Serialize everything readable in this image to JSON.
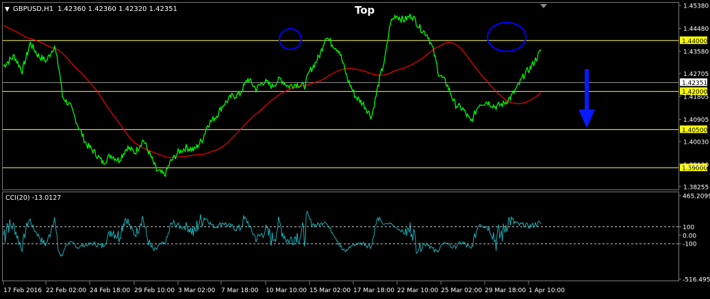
{
  "header": {
    "symbol": "GBPUSD,H1",
    "ohlc": "1.42360 1.42360 1.42320 1.42351",
    "annotation_top": "Top"
  },
  "colors": {
    "background": "#000000",
    "price_line": "#00ff00",
    "ma_line": "#ff0000",
    "level_line": "#ffff66",
    "current_line": "#9a9a9a",
    "circle": "#0000ff",
    "arrow": "#0a1aff",
    "cci_line": "#20c0c8",
    "label_bg": "#ffff00",
    "text": "#ffffff"
  },
  "chart_data": [
    {
      "type": "line",
      "name_label": "GBPUSD,H1",
      "ylim": [
        1.3825,
        1.4538
      ],
      "y_ticks": [
        "1.45380",
        "1.44480",
        "1.43580",
        "1.42705",
        "1.41805",
        "1.40905",
        "1.40030",
        "1.39130",
        "1.38255"
      ],
      "tick_values": [
        1.4538,
        1.4448,
        1.4358,
        1.42705,
        1.41805,
        1.40905,
        1.4003,
        1.3913,
        1.38255
      ],
      "levels": [
        {
          "value": 1.44,
          "label": "1.44000"
        },
        {
          "value": 1.42,
          "label": "1.42000"
        },
        {
          "value": 1.405,
          "label": "1.40500"
        },
        {
          "value": 1.39,
          "label": "1.39000"
        }
      ],
      "current": {
        "value": 1.42351,
        "label": "1.42351"
      },
      "x_labels": [
        "17 Feb 2016",
        "22 Feb 02:00",
        "24 Feb 18:00",
        "29 Feb 10:00",
        "3 Mar 02:00",
        "7 Mar 18:00",
        "10 Mar 10:00",
        "15 Mar 02:00",
        "17 Mar 18:00",
        "22 Mar 10:00",
        "25 Mar 02:00",
        "29 Mar 18:00",
        "1 Apr 10:00"
      ],
      "price_series": [
        [
          0,
          1.43
        ],
        [
          0.02,
          1.434
        ],
        [
          0.035,
          1.428
        ],
        [
          0.05,
          1.439
        ],
        [
          0.065,
          1.434
        ],
        [
          0.08,
          1.432
        ],
        [
          0.095,
          1.438
        ],
        [
          0.105,
          1.427
        ],
        [
          0.11,
          1.418
        ],
        [
          0.125,
          1.414
        ],
        [
          0.14,
          1.406
        ],
        [
          0.155,
          1.399
        ],
        [
          0.17,
          1.396
        ],
        [
          0.185,
          1.392
        ],
        [
          0.2,
          1.395
        ],
        [
          0.215,
          1.393
        ],
        [
          0.23,
          1.398
        ],
        [
          0.245,
          1.396
        ],
        [
          0.26,
          1.401
        ],
        [
          0.275,
          1.394
        ],
        [
          0.285,
          1.389
        ],
        [
          0.3,
          1.387
        ],
        [
          0.31,
          1.392
        ],
        [
          0.325,
          1.396
        ],
        [
          0.34,
          1.398
        ],
        [
          0.355,
          1.397
        ],
        [
          0.37,
          1.401
        ],
        [
          0.38,
          1.407
        ],
        [
          0.395,
          1.41
        ],
        [
          0.41,
          1.415
        ],
        [
          0.425,
          1.418
        ],
        [
          0.44,
          1.419
        ],
        [
          0.455,
          1.425
        ],
        [
          0.47,
          1.421
        ],
        [
          0.485,
          1.424
        ],
        [
          0.5,
          1.422
        ],
        [
          0.515,
          1.425
        ],
        [
          0.53,
          1.422
        ],
        [
          0.545,
          1.423
        ],
        [
          0.56,
          1.422
        ],
        [
          0.57,
          1.428
        ],
        [
          0.58,
          1.431
        ],
        [
          0.59,
          1.435
        ],
        [
          0.6,
          1.442
        ],
        [
          0.61,
          1.439
        ],
        [
          0.625,
          1.436
        ],
        [
          0.64,
          1.425
        ],
        [
          0.655,
          1.418
        ],
        [
          0.67,
          1.415
        ],
        [
          0.685,
          1.41
        ],
        [
          0.7,
          1.425
        ],
        [
          0.71,
          1.433
        ],
        [
          0.72,
          1.447
        ],
        [
          0.73,
          1.45
        ],
        [
          0.745,
          1.448
        ],
        [
          0.76,
          1.45
        ],
        [
          0.775,
          1.445
        ],
        [
          0.79,
          1.442
        ],
        [
          0.8,
          1.436
        ],
        [
          0.81,
          1.427
        ],
        [
          0.825,
          1.423
        ],
        [
          0.84,
          1.415
        ],
        [
          0.855,
          1.413
        ],
        [
          0.87,
          1.408
        ],
        [
          0.885,
          1.415
        ],
        [
          0.9,
          1.416
        ],
        [
          0.915,
          1.414
        ],
        [
          0.93,
          1.415
        ],
        [
          0.945,
          1.418
        ],
        [
          0.96,
          1.423
        ],
        [
          0.97,
          1.427
        ],
        [
          0.98,
          1.429
        ],
        [
          1.0,
          1.436
        ]
      ]
    },
    {
      "type": "line",
      "name_label": "CCI(20) -13.0127",
      "ylim": [
        -516.4956,
        465.2099
      ],
      "y_ticks": [
        "465.2099",
        "100",
        "0.00",
        "-100",
        "-516.4956"
      ],
      "tick_values": [
        465.2099,
        100,
        0,
        -100,
        -516.4956
      ],
      "dashed_levels": [
        100,
        -100
      ]
    }
  ]
}
